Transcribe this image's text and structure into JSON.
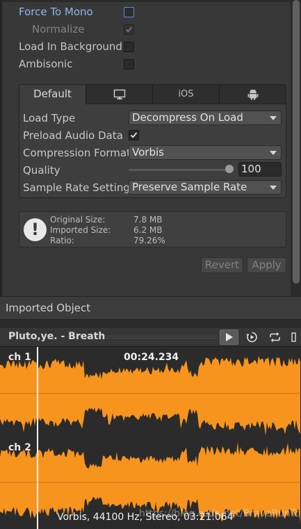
{
  "settings": {
    "force_to_mono": {
      "label": "Force To Mono",
      "checked": false
    },
    "normalize": {
      "label": "Normalize",
      "checked": true,
      "disabled": true
    },
    "load_in_background": {
      "label": "Load In Background",
      "checked": false
    },
    "ambisonic": {
      "label": "Ambisonic",
      "checked": false
    }
  },
  "platform_tabs": [
    {
      "label": "Default",
      "icon": null,
      "active": true
    },
    {
      "label": "",
      "icon": "monitor-icon",
      "active": false
    },
    {
      "label": "iOS",
      "icon": null,
      "active": false
    },
    {
      "label": "",
      "icon": "android-icon",
      "active": false
    }
  ],
  "platform_settings": {
    "load_type": {
      "label": "Load Type",
      "value": "Decompress On Load"
    },
    "preload_audio_data": {
      "label": "Preload Audio Data",
      "checked": true
    },
    "compression_format": {
      "label": "Compression Format",
      "value": "Vorbis"
    },
    "quality": {
      "label": "Quality",
      "value": "100",
      "slider_fraction": 1.0
    },
    "sample_rate_setting": {
      "label": "Sample Rate Setting",
      "value": "Preserve Sample Rate"
    }
  },
  "info": {
    "original_size": {
      "label": "Original Size:",
      "value": "7.8 MB"
    },
    "imported_size": {
      "label": "Imported Size:",
      "value": "6.2 MB"
    },
    "ratio": {
      "label": "Ratio:",
      "value": "79.26%"
    }
  },
  "buttons": {
    "revert": "Revert",
    "apply": "Apply"
  },
  "imported_object": {
    "title": "Imported Object"
  },
  "preview": {
    "title": "Pluto,ye. - Breath",
    "channel_1": "ch 1",
    "channel_2": "ch 2",
    "time": "00:24.234",
    "format_info": "Vorbis, 44100 Hz, Stereo, 03:21.064",
    "watermark": "https://blog.csdn.net/BraveRunTo"
  },
  "colors": {
    "accent_label": "#8eb7f0",
    "waveform": "#f7941e",
    "background": "#383838"
  }
}
